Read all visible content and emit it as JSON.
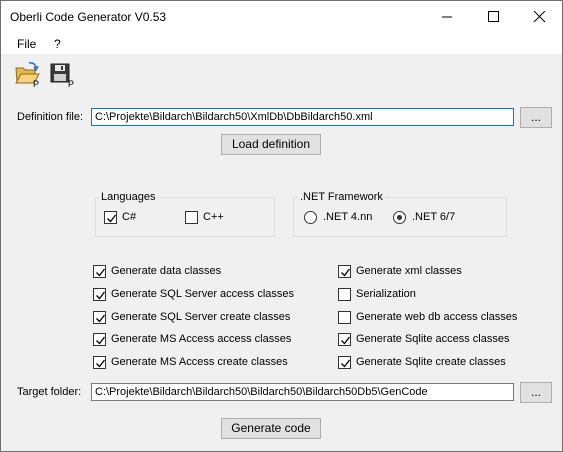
{
  "window": {
    "title": "Oberli Code Generator V0.53",
    "minimize_icon": "minimize-icon",
    "maximize_icon": "maximize-icon",
    "close_icon": "close-icon"
  },
  "menu": {
    "file": "File",
    "help": "?"
  },
  "toolbar": {
    "open_icon": "open-folder-icon",
    "save_icon": "save-icon"
  },
  "definition": {
    "label": "Definition file:",
    "value": "C:\\Projekte\\Bildarch\\Bildarch50\\XmlDb\\DbBildarch50.xml",
    "browse": "...",
    "load_button": "Load definition"
  },
  "languages": {
    "title": "Languages",
    "options": [
      {
        "label": "C#",
        "checked": true
      },
      {
        "label": "C++",
        "checked": false
      }
    ]
  },
  "framework": {
    "title": ".NET Framework",
    "options": [
      {
        "label": ".NET 4.nn",
        "selected": false
      },
      {
        "label": ".NET 6/7",
        "selected": true
      }
    ]
  },
  "options_left": [
    {
      "label": "Generate data classes",
      "checked": true
    },
    {
      "label": "Generate SQL Server access classes",
      "checked": true
    },
    {
      "label": "Generate SQL Server create classes",
      "checked": true
    },
    {
      "label": "Generate MS Access access classes",
      "checked": true
    },
    {
      "label": "Generate MS Access create classes",
      "checked": true
    }
  ],
  "options_right": [
    {
      "label": "Generate xml classes",
      "checked": true
    },
    {
      "label": "Serialization",
      "checked": false
    },
    {
      "label": "Generate web db access classes",
      "checked": false
    },
    {
      "label": "Generate Sqlite access classes",
      "checked": true
    },
    {
      "label": "Generate Sqlite create classes",
      "checked": true
    }
  ],
  "target": {
    "label": "Target folder:",
    "value": "C:\\Projekte\\Bildarch\\Bildarch50\\Bildarch50\\Bildarch50Db5\\GenCode",
    "browse": "..."
  },
  "generate_button": "Generate code"
}
